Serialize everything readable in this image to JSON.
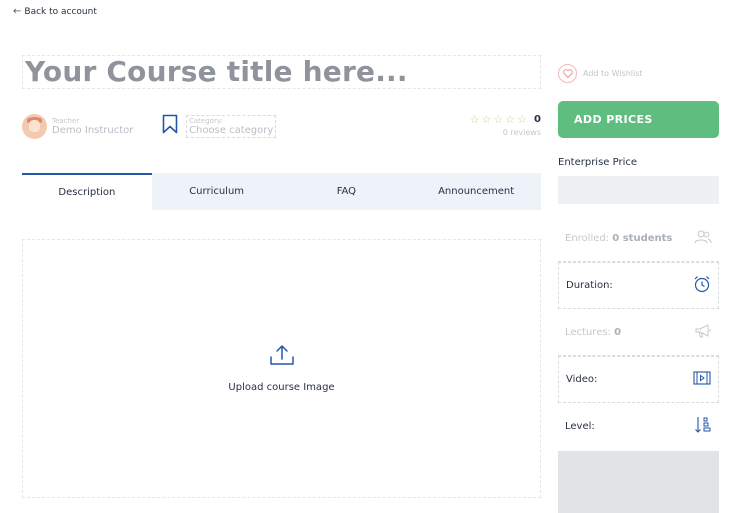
{
  "nav": {
    "back_label": "Back to account"
  },
  "course": {
    "title_placeholder": "Your Course title here...",
    "wishlist_label": "Add to Wishlist",
    "teacher": {
      "label": "Teacher",
      "name": "Demo Instructor"
    },
    "category": {
      "label": "Category:",
      "value": "Choose category"
    },
    "rating": {
      "value": "0",
      "reviews": "0 reviews",
      "stars": [
        "☆",
        "☆",
        "☆",
        "☆",
        "☆"
      ]
    }
  },
  "tabs": [
    "Description",
    "Curriculum",
    "FAQ",
    "Announcement"
  ],
  "upload": {
    "label": "Upload course Image"
  },
  "sidebar": {
    "add_prices_label": "ADD PRICES",
    "enterprise_price_label": "Enterprise Price",
    "enterprise_price_value": "",
    "enrolled_label": "Enrolled:",
    "enrolled_value": "0 students",
    "duration_label": "Duration:",
    "lectures_label": "Lectures:",
    "lectures_value": "0",
    "video_label": "Video:",
    "level_label": "Level:"
  },
  "colors": {
    "accent": "#2557a7",
    "button": "#5ebd7f",
    "tab_bg": "#eef2f9",
    "heart": "#f4b9b9"
  },
  "icons": [
    "arrow-left-icon",
    "heart-icon",
    "bookmark-icon",
    "star-icon",
    "upload-icon",
    "users-icon",
    "alarm-clock-icon",
    "megaphone-icon",
    "video-icon",
    "level-icon"
  ]
}
